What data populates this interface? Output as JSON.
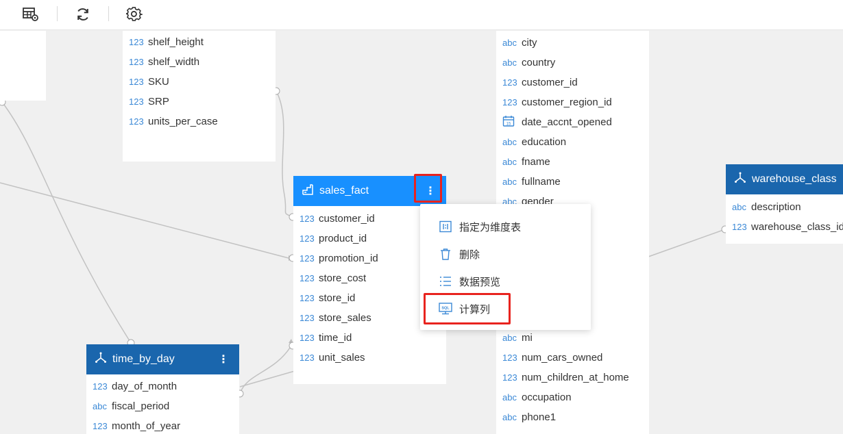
{
  "toolbar": {
    "icons": [
      "table-settings-icon",
      "refresh-icon",
      "settings-icon"
    ]
  },
  "colors": {
    "header_dark": "#1a66ad",
    "header_active": "#1890ff",
    "type_badge": "#3a88d6",
    "highlight": "#e8231e"
  },
  "product_table": {
    "fields": [
      {
        "type": "123",
        "name": "shelf_height"
      },
      {
        "type": "123",
        "name": "shelf_width"
      },
      {
        "type": "123",
        "name": "SKU"
      },
      {
        "type": "123",
        "name": "SRP"
      },
      {
        "type": "123",
        "name": "units_per_case"
      }
    ]
  },
  "sales_fact": {
    "title": "sales_fact",
    "more": "⋮",
    "fields": [
      {
        "type": "123",
        "name": "customer_id"
      },
      {
        "type": "123",
        "name": "product_id"
      },
      {
        "type": "123",
        "name": "promotion_id"
      },
      {
        "type": "123",
        "name": "store_cost"
      },
      {
        "type": "123",
        "name": "store_id"
      },
      {
        "type": "123",
        "name": "store_sales"
      },
      {
        "type": "123",
        "name": "time_id"
      },
      {
        "type": "123",
        "name": "unit_sales"
      }
    ]
  },
  "customer_table": {
    "fields": [
      {
        "type": "abc",
        "name": "city"
      },
      {
        "type": "abc",
        "name": "country"
      },
      {
        "type": "123",
        "name": "customer_id"
      },
      {
        "type": "123",
        "name": "customer_region_id"
      },
      {
        "type": "date",
        "name": "date_accnt_opened"
      },
      {
        "type": "abc",
        "name": "education"
      },
      {
        "type": "abc",
        "name": "fname"
      },
      {
        "type": "abc",
        "name": "fullname"
      },
      {
        "type": "abc",
        "name": "gender"
      }
    ],
    "fields_lower": [
      {
        "type": "abc",
        "name": "mi"
      },
      {
        "type": "123",
        "name": "num_cars_owned"
      },
      {
        "type": "123",
        "name": "num_children_at_home"
      },
      {
        "type": "abc",
        "name": "occupation"
      },
      {
        "type": "abc",
        "name": "phone1"
      }
    ]
  },
  "warehouse_class": {
    "title": "warehouse_class",
    "fields": [
      {
        "type": "abc",
        "name": "description"
      },
      {
        "type": "123",
        "name": "warehouse_class_id"
      }
    ]
  },
  "time_by_day": {
    "title": "time_by_day",
    "more": "⋮",
    "fields": [
      {
        "type": "123",
        "name": "day_of_month"
      },
      {
        "type": "abc",
        "name": "fiscal_period"
      },
      {
        "type": "123",
        "name": "month_of_year"
      }
    ]
  },
  "context_menu": {
    "items": [
      {
        "label": "指定为维度表",
        "icon": "dimension-table-icon"
      },
      {
        "label": "删除",
        "icon": "trash-icon"
      },
      {
        "label": "数据预览",
        "icon": "list-preview-icon"
      },
      {
        "label": "计算列",
        "icon": "sql-monitor-icon"
      }
    ]
  }
}
